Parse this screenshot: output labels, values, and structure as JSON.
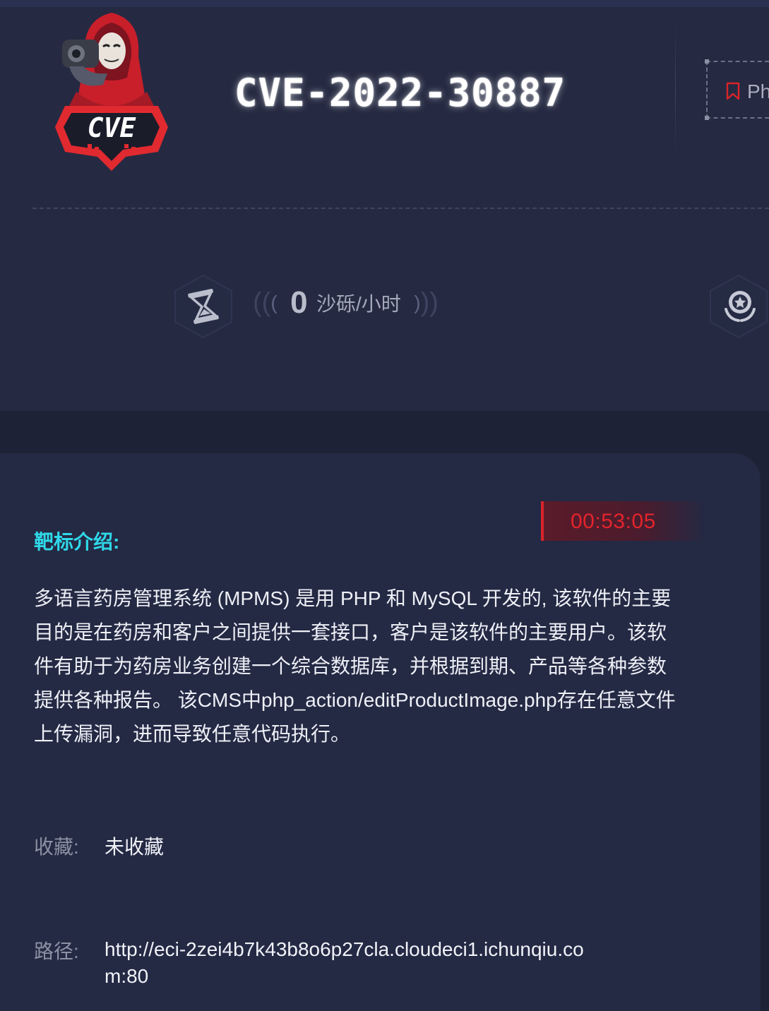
{
  "header": {
    "logo_text": "CVE",
    "title": "CVE-2022-30887",
    "tag_label": "Ph",
    "rate_value": "0",
    "rate_unit": "沙砾/小时"
  },
  "timer": "00:53:05",
  "intro": {
    "label": "靶标介绍:",
    "text": "多语言药房管理系统 (MPMS) 是用 PHP 和 MySQL 开发的, 该软件的主要目的是在药房和客户之间提供一套接口，客户是该软件的主要用户。该软件有助于为药房业务创建一个综合数据库，并根据到期、产品等各种参数提供各种报告。 该CMS中php_action/editProductImage.php存在任意文件上传漏洞，进而导致任意代码执行。"
  },
  "favorite": {
    "label": "收藏:",
    "value": "未收藏"
  },
  "path": {
    "label": "路径:",
    "value": "http://eci-2zei4b7k43b8o6p27cla.cloudeci1.ichunqiu.com:80"
  },
  "colors": {
    "accent_cyan": "#2fd8e8",
    "timer_red": "#e3242b",
    "header_bg": "#252a42",
    "card_bg": "#242944"
  },
  "icons": [
    "cve-logo-icon",
    "bookmark-icon",
    "hourglass-icon",
    "medal-icon"
  ]
}
